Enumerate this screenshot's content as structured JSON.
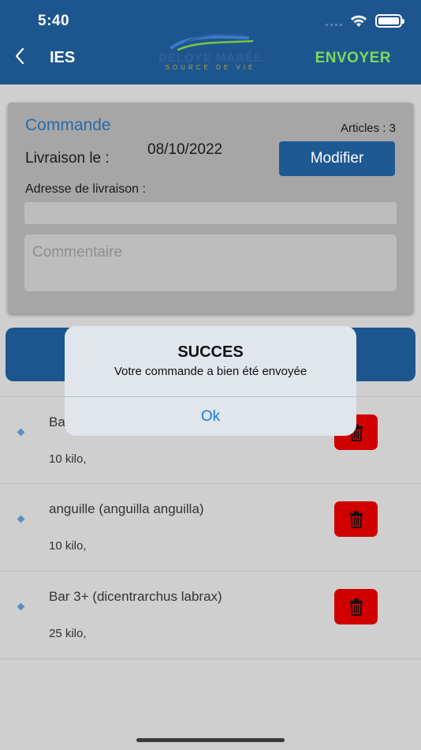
{
  "status_bar": {
    "time": "5:40"
  },
  "header": {
    "back_icon": "chevron-left-icon",
    "title": "IES",
    "logo_name": "DELOYE MARÉE",
    "logo_tagline": "SOURCE DE VIE",
    "send_label": "ENVOYER",
    "send_color": "#7ed957",
    "background": "#1d568f"
  },
  "order": {
    "title": "Commande",
    "articles": "Articles : 3",
    "delivery_label": "Livraison le :",
    "delivery_date": "08/10/2022",
    "modify_label": "Modifier",
    "address_label": "Adresse de livraison :",
    "address_value": "",
    "comment_placeholder": "Commentaire"
  },
  "items": [
    {
      "name": "Bar",
      "qty": "10 kilo,"
    },
    {
      "name": "anguille (anguilla anguilla)",
      "qty": "10 kilo,"
    },
    {
      "name": "Bar 3+ (dicentrarchus labrax)",
      "qty": "25 kilo,"
    }
  ],
  "alert": {
    "title": "SUCCES",
    "message": "Votre commande a bien été envoyée",
    "ok_label": "Ok",
    "ok_color": "#1b7be0"
  },
  "colors": {
    "accent": "#1d568f",
    "delete": "#d00000"
  }
}
